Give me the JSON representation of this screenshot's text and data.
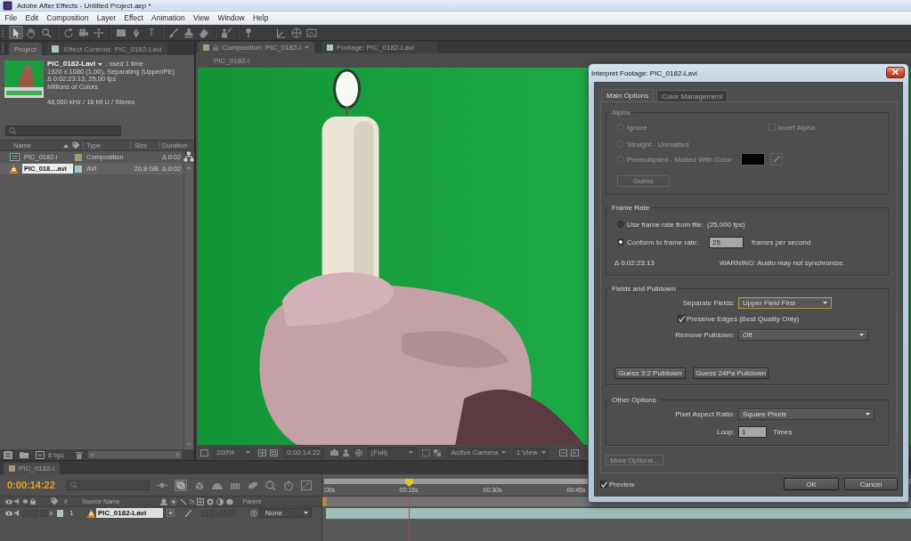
{
  "window": {
    "title": "Adobe After Effects - Untitled Project.aep *"
  },
  "menu": [
    "File",
    "Edit",
    "Composition",
    "Layer",
    "Effect",
    "Animation",
    "View",
    "Window",
    "Help"
  ],
  "toolbar": {
    "tools": [
      {
        "kind": "selection",
        "selected": true
      },
      {
        "kind": "hand",
        "selected": false
      },
      {
        "kind": "zoom",
        "selected": false
      },
      {
        "kind": "rotation",
        "selected": false
      },
      {
        "kind": "orbit",
        "selected": false
      },
      {
        "kind": "pan_behind",
        "selected": false
      },
      {
        "kind": "shape",
        "selected": false
      },
      {
        "kind": "pen",
        "selected": false
      },
      {
        "kind": "type",
        "glyph": "T",
        "selected": false
      },
      {
        "kind": "brush",
        "selected": false
      },
      {
        "kind": "clone",
        "selected": false
      },
      {
        "kind": "eraser",
        "selected": false
      },
      {
        "kind": "roto",
        "selected": false
      },
      {
        "kind": "puppet",
        "selected": false
      },
      {
        "kind": "axis_local",
        "selected": false
      },
      {
        "kind": "axis_world",
        "selected": false
      },
      {
        "kind": "axis_view",
        "selected": false
      }
    ]
  },
  "project": {
    "tabs": [
      {
        "kind": "project",
        "label": "Project",
        "selected": true
      },
      {
        "kind": "effect_controls",
        "label": "Effect Controls: PIC_0182-Lavi",
        "selected": false
      }
    ],
    "info": {
      "name": "PIC_0182-Lavi",
      "usage": ", used 1 time",
      "details": [
        "1920 x 1080 (1,00), Separating (Upper/PE)",
        "Δ 0:02:23:13, 25,00 fps",
        "Millions of Colors"
      ],
      "audio": "48,000 kHz / 16 bit U / Stereo"
    },
    "columns": [
      "Name",
      "Type",
      "Size",
      "Duration"
    ],
    "rows": [
      {
        "kind": "composition",
        "name": "PIC_0182-l",
        "color": "#a89b70",
        "type": "Composition",
        "duration": "Δ 0:02",
        "selected": false
      },
      {
        "kind": "footage",
        "name": "PIC_018....avi",
        "color": "#a3c9c5",
        "type": "AVI",
        "size": "20,8 GB",
        "duration": "Δ 0:02",
        "selected": true
      }
    ],
    "depth": "8 bpc"
  },
  "viewer": {
    "tabs": [
      {
        "kind": "composition",
        "label": "Composition: PIC_0182-l",
        "selected": true
      },
      {
        "kind": "footage",
        "label": "Footage: PIC_0182-Lavi",
        "selected": false
      }
    ],
    "breadcrumb": "PIC_0182-l",
    "zoom": "200%",
    "time": "0:00:14:22",
    "resolution": "(Full)",
    "camera": "Active Camera",
    "views": "1 View"
  },
  "timeline": {
    "tab": "PIC_0182-l",
    "time": "0:00:14:22",
    "columns": [
      "#",
      "Source Name",
      "Parent"
    ],
    "effects_switch": "fx",
    "ruler": [
      ":00s",
      "00:15s",
      "00:30s",
      "00:45s"
    ],
    "playhead": {
      "level": 0.147
    },
    "layers": [
      {
        "number": "1",
        "name": "PIC_0182-Lavi",
        "color": "#a3c9c5",
        "parent": "None",
        "selected": true
      }
    ]
  },
  "dialog": {
    "title": "Interpret Footage: PIC_0182-Lavi",
    "tabs": [
      {
        "label": "Main Options",
        "selected": true
      },
      {
        "label": "Color Management",
        "selected": false
      }
    ],
    "alpha": {
      "title": "Alpha",
      "disabled": true,
      "options": [
        {
          "label": "Ignore",
          "selected": false
        },
        {
          "label": "Straight - Unmatted",
          "selected": false
        },
        {
          "label": "Premultiplied - Matted With Color:",
          "selected": false
        }
      ],
      "invert": {
        "label": "Invert Alpha",
        "checked": false
      },
      "guess": "Guess"
    },
    "frame_rate": {
      "title": "Frame Rate",
      "options": [
        {
          "label": "Use frame rate from file:",
          "note": "(25,000 fps)",
          "selected": false
        },
        {
          "label": "Conform to frame rate:",
          "value": "25",
          "unit": "frames per second",
          "selected": true
        }
      ],
      "duration": "Δ 0:02:23:13",
      "warning": "WARNING: Audio may not synchronize."
    },
    "fields": {
      "title": "Fields and Pulldown",
      "separate": {
        "label": "Separate Fields:",
        "value": "Upper Field First",
        "focused": true
      },
      "preserve_edges": {
        "label": "Preserve Edges (Best Quality Only)",
        "checked": true
      },
      "pulldown": {
        "label": "Remove Pulldown:",
        "value": "Off",
        "focused": false
      },
      "buttons": [
        "Guess 3:2 Pulldown",
        "Guess 24Pa Pulldown"
      ]
    },
    "other": {
      "title": "Other Options",
      "pixel_aspect": {
        "label": "Pixel Aspect Ratio:",
        "value": "Square Pixels",
        "focused": false
      },
      "loop": {
        "label": "Loop:",
        "value": "1",
        "unit": "Times"
      }
    },
    "more_options": {
      "label": "More Options...",
      "disabled": true
    },
    "preview": {
      "label": "Preview",
      "checked": true
    },
    "buttons": [
      "OK",
      "Cancel"
    ]
  }
}
